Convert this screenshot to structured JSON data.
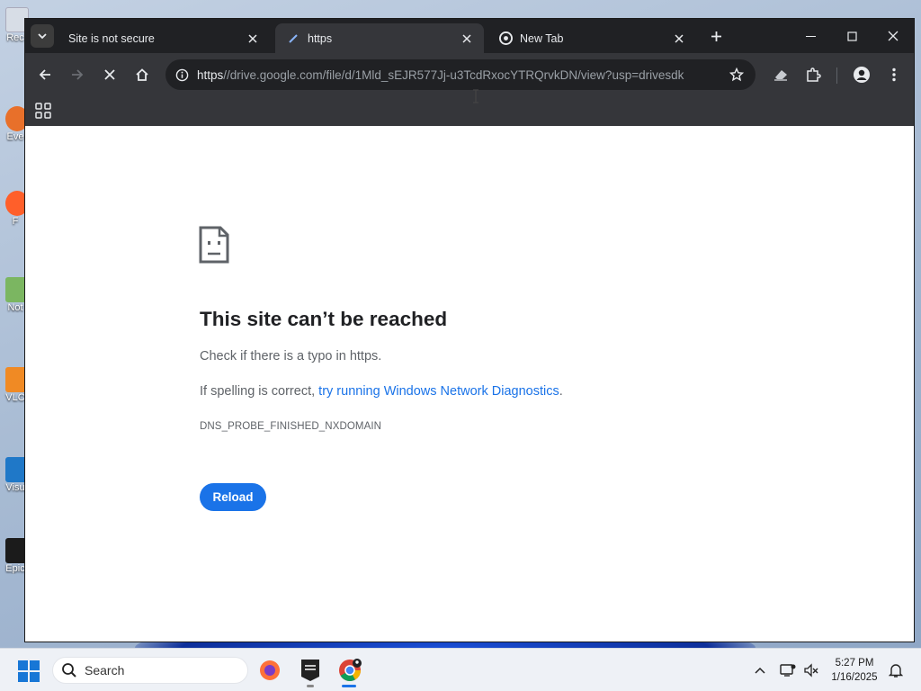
{
  "desktop": {
    "icons": [
      {
        "label": "Rec"
      },
      {
        "label": "Eve"
      },
      {
        "label": "F"
      },
      {
        "label": "Not"
      },
      {
        "label": "VLC"
      },
      {
        "label": "Visu"
      },
      {
        "label": "Epic"
      }
    ]
  },
  "browser": {
    "tabs": [
      {
        "title": "Site is not secure",
        "active": false
      },
      {
        "title": "https",
        "active": true
      },
      {
        "title": "New Tab",
        "active": false
      }
    ],
    "address_bar": {
      "url_scheme": "https",
      "url_rest": "//drive.google.com/file/d/1Mld_sEJR577Jj-u3TcdRxocYTRQrvkDN/view?usp=drivesdk"
    }
  },
  "error_page": {
    "title": "This site can’t be reached",
    "line1": "Check if there is a typo in https.",
    "line2_prefix": "If spelling is correct, ",
    "line2_link": "try running Windows Network Diagnostics",
    "line2_suffix": ".",
    "error_code": "DNS_PROBE_FINISHED_NXDOMAIN",
    "reload_label": "Reload"
  },
  "taskbar": {
    "search_placeholder": "Search",
    "time": "5:27 PM",
    "date": "1/16/2025"
  },
  "colors": {
    "accent": "#1a73e8",
    "tabstrip": "#202124",
    "toolbar": "#35363a"
  }
}
